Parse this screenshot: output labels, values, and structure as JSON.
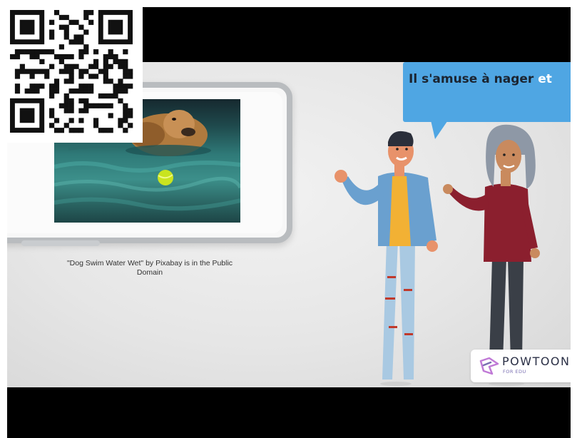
{
  "video": {
    "caption_line1": "\"Dog Swim Water Wet\" by Pixabay is in the Public",
    "caption_line2": "Domain",
    "speech_main": "Il s'amuse à nager ",
    "speech_highlight": "et",
    "logo_word": "POWTOON",
    "logo_sub": "FOR EDU",
    "photo_subject": "dog-swimming-with-ball",
    "qr_icon": "qr-code-icon"
  },
  "colors": {
    "bubble": "#4fa6e3",
    "letterbox": "#000000",
    "highlight": "#ffffff"
  }
}
